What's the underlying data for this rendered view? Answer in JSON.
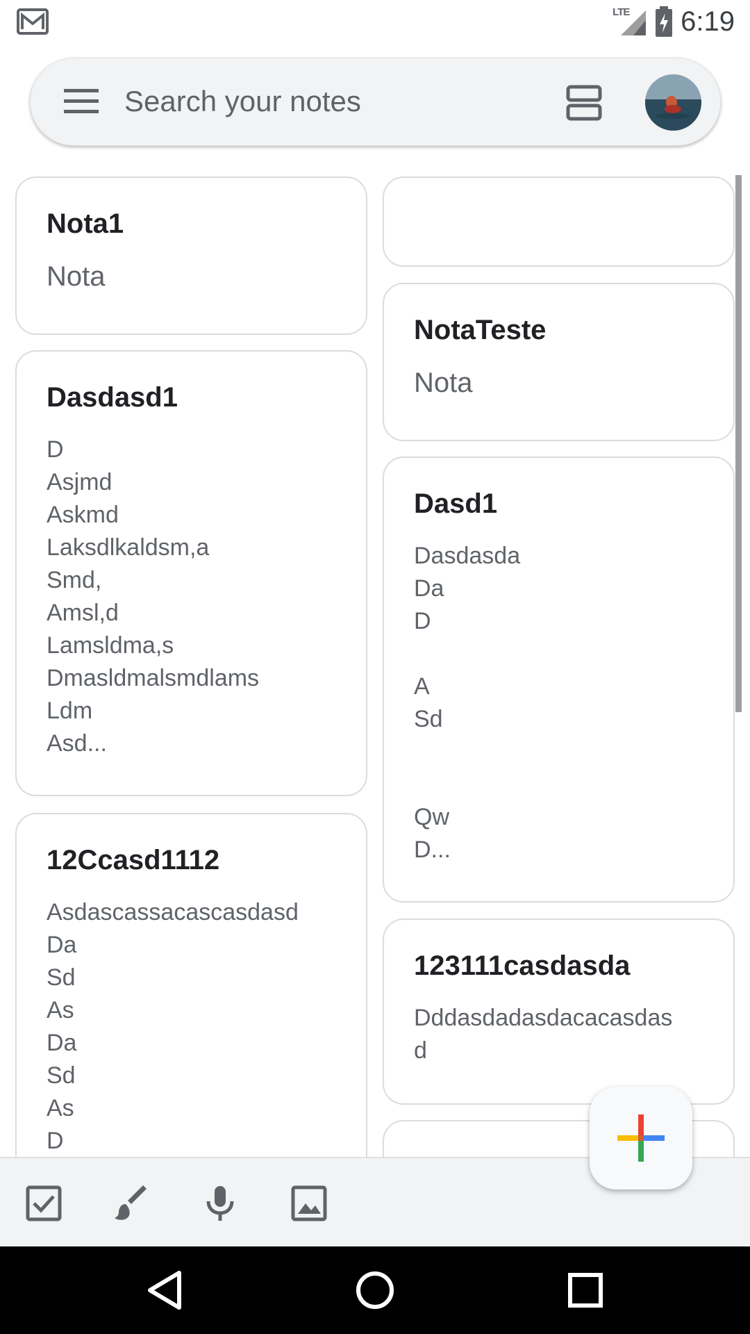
{
  "status_bar": {
    "time": "6:19",
    "network": "LTE",
    "icons": [
      "gmail-icon",
      "lte-signal-icon",
      "battery-charging-icon"
    ]
  },
  "search": {
    "placeholder": "Search your notes",
    "icons": [
      "menu-icon",
      "view-toggle-icon",
      "avatar"
    ]
  },
  "notes": {
    "left_column": [
      {
        "title": "Nota1",
        "body": "Nota"
      },
      {
        "title": "Dasdasd1",
        "body": "D\nAsjmd\nAskmd\nLaksdlkaldsm,a\nSmd,\nAmsl,d\nLamsldma,s\nDmasldmalsmdlams\nLdm\n Asd..."
      },
      {
        "title": "12Ccasd1112",
        "body": "Asdascassacascasdasd\nDa\nSd\nAs\nDa\nSd\nAs\nD"
      }
    ],
    "right_column": [
      {
        "title": "",
        "body": ""
      },
      {
        "title": "NotaTeste",
        "body": "Nota"
      },
      {
        "title": "Dasd1",
        "body": "Dasdasda\nDa\nD\n\nA\nSd\n\n\nQw\nD..."
      },
      {
        "title": "123111casdasda",
        "body": "Dddasdadasdacacasdas\nd"
      },
      {
        "title": "",
        "body": ""
      }
    ]
  },
  "bottom_bar": {
    "actions": [
      "checkbox-list-icon",
      "brush-icon",
      "microphone-icon",
      "image-icon"
    ],
    "fab": "add-note-icon",
    "fab_colors": [
      "#ea4335",
      "#fbbc04",
      "#34a853",
      "#4285f4"
    ]
  },
  "nav_bar": {
    "buttons": [
      "back-icon",
      "home-icon",
      "recents-icon"
    ]
  }
}
